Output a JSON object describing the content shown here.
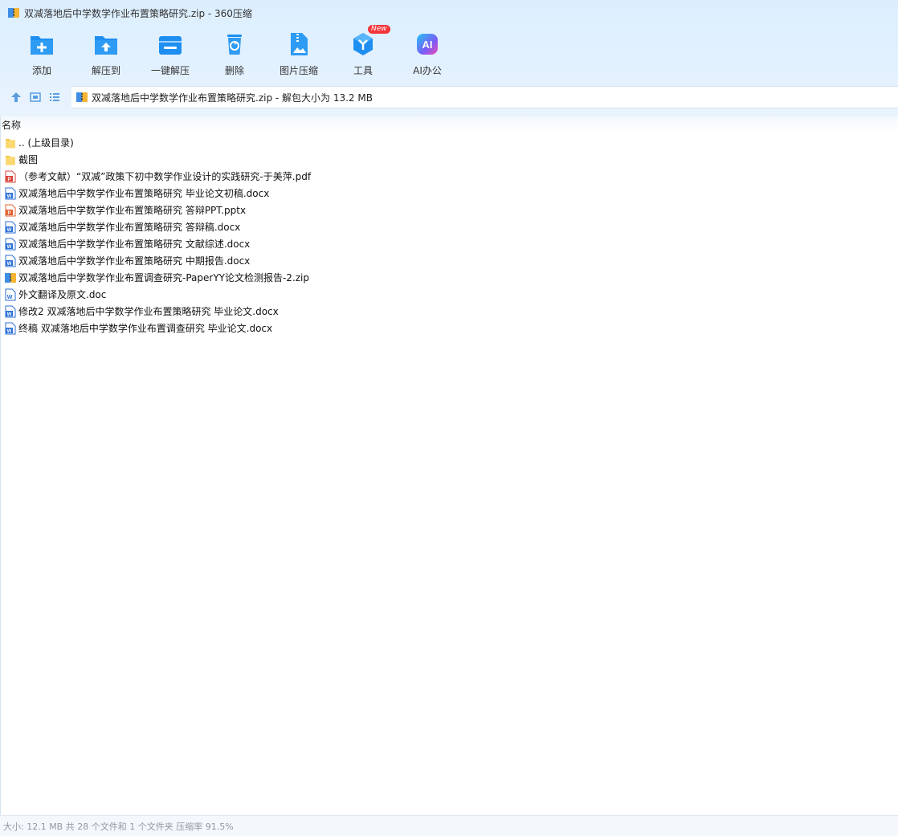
{
  "window": {
    "title": "双减落地后中学数学作业布置策略研究.zip - 360压缩"
  },
  "toolbar": {
    "items": [
      {
        "label": "添加",
        "icon": "add-icon"
      },
      {
        "label": "解压到",
        "icon": "extract-to-icon"
      },
      {
        "label": "一键解压",
        "icon": "one-click-extract-icon"
      },
      {
        "label": "删除",
        "icon": "delete-icon"
      },
      {
        "label": "图片压缩",
        "icon": "image-compress-icon"
      },
      {
        "label": "工具",
        "icon": "tools-icon",
        "badge": "New"
      },
      {
        "label": "AI办公",
        "icon": "ai-office-icon"
      }
    ]
  },
  "address": {
    "text": "双减落地后中学数学作业布置策略研究.zip - 解包大小为 13.2 MB"
  },
  "list": {
    "column_name": "名称",
    "rows": [
      {
        "name": ".. (上级目录)",
        "type": "folder"
      },
      {
        "name": "截图",
        "type": "folder"
      },
      {
        "name": "（参考文献）“双减”政策下初中数学作业设计的实践研究-于美萍.pdf",
        "type": "pdf"
      },
      {
        "name": "双减落地后中学数学作业布置策略研究 毕业论文初稿.docx",
        "type": "docx"
      },
      {
        "name": "双减落地后中学数学作业布置策略研究 答辩PPT.pptx",
        "type": "pptx"
      },
      {
        "name": "双减落地后中学数学作业布置策略研究 答辩稿.docx",
        "type": "docx"
      },
      {
        "name": "双减落地后中学数学作业布置策略研究 文献综述.docx",
        "type": "docx"
      },
      {
        "name": "双减落地后中学数学作业布置策略研究 中期报告.docx",
        "type": "docx"
      },
      {
        "name": "双减落地后中学数学作业布置调查研究-PaperYY论文检测报告-2.zip",
        "type": "zip"
      },
      {
        "name": "外文翻译及原文.doc",
        "type": "doc"
      },
      {
        "name": "修改2 双减落地后中学数学作业布置策略研究 毕业论文.docx",
        "type": "docx"
      },
      {
        "name": "终稿 双减落地后中学数学作业布置调查研究 毕业论文.docx",
        "type": "docx"
      }
    ]
  },
  "status": {
    "text": "大小: 12.1 MB 共 28 个文件和 1 个文件夹 压缩率 91.5%"
  },
  "colors": {
    "accent_blue": "#1e8ff0",
    "toolbar_bg": "#e3f1ff",
    "new_badge": "#f2363b"
  }
}
